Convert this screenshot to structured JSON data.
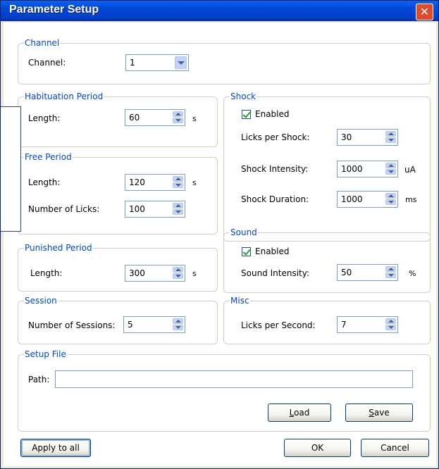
{
  "window": {
    "title": "Parameter Setup",
    "close_glyph": "✕"
  },
  "channel": {
    "legend": "Channel",
    "label": "Channel:",
    "value": "1"
  },
  "habituation": {
    "legend": "Habituation Period",
    "length_label": "Length:",
    "length_value": "60",
    "length_unit": "s"
  },
  "free": {
    "legend": "Free Period",
    "length_label": "Length:",
    "length_value": "120",
    "length_unit": "s",
    "licks_label": "Number of Licks:",
    "licks_value": "100"
  },
  "punished": {
    "legend": "Punished Period",
    "length_label": "Length:",
    "length_value": "300",
    "length_unit": "s"
  },
  "session": {
    "legend": "Session",
    "sessions_label": "Number of Sessions:",
    "sessions_value": "5"
  },
  "shock": {
    "legend": "Shock",
    "enabled_label": "Enabled",
    "enabled": true,
    "licks_label": "Licks per Shock:",
    "licks_value": "30",
    "intensity_label": "Shock Intensity:",
    "intensity_value": "1000",
    "intensity_unit": "uA",
    "duration_label": "Shock Duration:",
    "duration_value": "1000",
    "duration_unit": "ms"
  },
  "sound": {
    "legend": "Sound",
    "enabled_label": "Enabled",
    "enabled": true,
    "intensity_label": "Sound Intensity:",
    "intensity_value": "50",
    "intensity_unit": "%"
  },
  "misc": {
    "legend": "Misc",
    "licks_label": "Licks per Second:",
    "licks_value": "7"
  },
  "setup_file": {
    "legend": "Setup File",
    "path_label": "Path:",
    "path_value": "",
    "load_label_accel": "L",
    "load_label_rest": "oad",
    "save_label_accel": "S",
    "save_label_rest": "ave"
  },
  "footer": {
    "apply_label": "Apply to all",
    "ok_label": "OK",
    "cancel_label": "Cancel"
  }
}
